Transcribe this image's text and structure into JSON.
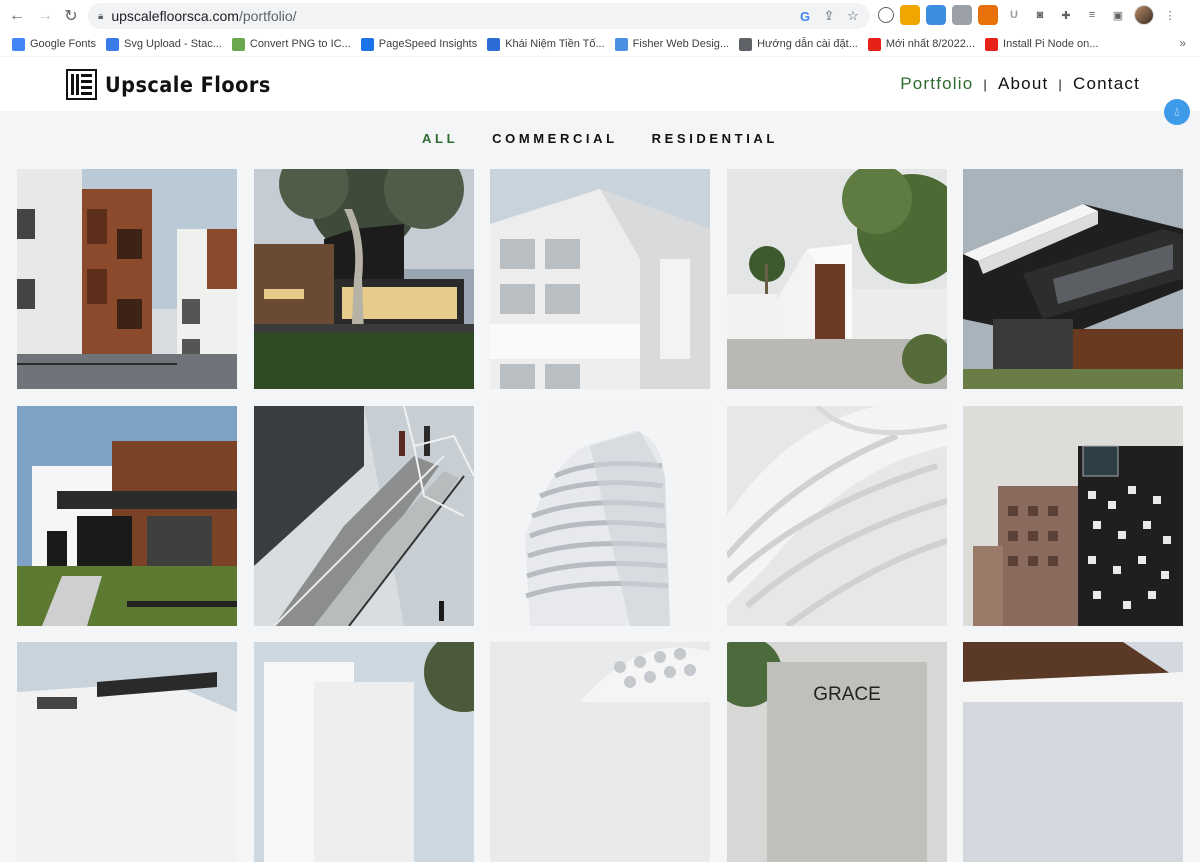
{
  "browser": {
    "url_host": "upscalefloorsca.com",
    "url_path": "/portfolio/",
    "bookmarks": [
      {
        "label": "Google Fonts",
        "color": "#4285f4"
      },
      {
        "label": "Svg Upload - Stac...",
        "color": "#3a7bea"
      },
      {
        "label": "Convert PNG to IC...",
        "color": "#6aa84f"
      },
      {
        "label": "PageSpeed Insights",
        "color": "#1a73e8"
      },
      {
        "label": "Khái Niệm Tiền Tố...",
        "color": "#2b6cd6"
      },
      {
        "label": "Fisher Web Desig...",
        "color": "#4a90e2"
      },
      {
        "label": "Hướng dẫn cài đặt...",
        "color": "#5f6368"
      },
      {
        "label": "Mới nhất 8/2022...",
        "color": "#e62117"
      },
      {
        "label": "Install Pi Node on...",
        "color": "#e62117"
      }
    ]
  },
  "site": {
    "brand": "Upscale Floors",
    "nav": [
      {
        "label": "Portfolio",
        "active": true
      },
      {
        "label": "About",
        "active": false
      },
      {
        "label": "Contact",
        "active": false
      }
    ],
    "filters": [
      {
        "label": "ALL",
        "active": true
      },
      {
        "label": "COMMERCIAL",
        "active": false
      },
      {
        "label": "RESIDENTIAL",
        "active": false
      }
    ],
    "accent_color": "#2e6b30",
    "tiles": [
      {
        "name": "apartment-wood-balconies"
      },
      {
        "name": "modern-house-tree-dusk"
      },
      {
        "name": "white-cube-building"
      },
      {
        "name": "white-house-palm"
      },
      {
        "name": "cantilever-dark-building"
      },
      {
        "name": "wood-clad-house"
      },
      {
        "name": "glass-staircase"
      },
      {
        "name": "wavy-white-tower"
      },
      {
        "name": "white-curved-facade"
      },
      {
        "name": "brick-towers"
      },
      {
        "name": "modern-villa-roof"
      },
      {
        "name": "white-boxes-house"
      },
      {
        "name": "perforated-facade"
      },
      {
        "name": "grace-storefront",
        "sign": "GRACE"
      },
      {
        "name": "wood-overhang"
      }
    ]
  }
}
